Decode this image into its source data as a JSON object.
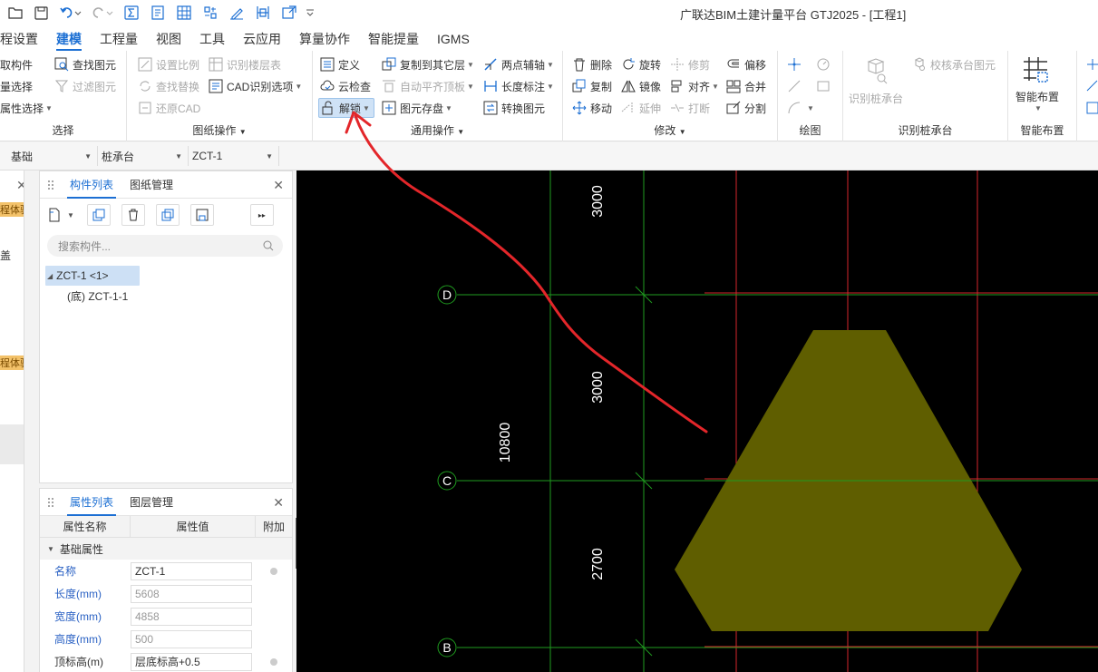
{
  "window": {
    "title": "广联达BIM土建计量平台 GTJ2025 - [工程1]"
  },
  "quick_access": [
    "folder-icon",
    "save-icon",
    "undo-icon",
    "redo-icon",
    "sum-icon",
    "report-icon",
    "grid-icon",
    "layout-icon",
    "pen-icon",
    "split-icon",
    "export-icon",
    "more-icon"
  ],
  "menu": {
    "tabs": [
      "程设置",
      "建模",
      "工程量",
      "视图",
      "工具",
      "云应用",
      "算量协作",
      "智能提量",
      "IGMS"
    ],
    "active": 1
  },
  "ribbon": {
    "select": {
      "items": [
        "取构件",
        "量选择",
        "属性选择"
      ],
      "label": "选择"
    },
    "drawing": {
      "items": [
        "查找图元",
        "过滤图元",
        "设置比例",
        "查找替换",
        "还原CAD",
        "识别楼层表",
        "CAD识别选项"
      ],
      "label": "图纸操作"
    },
    "common": {
      "items": [
        "定义",
        "云检查",
        "解锁",
        "复制到其它层",
        "自动平齐顶板",
        "图元存盘",
        "两点辅轴",
        "长度标注",
        "转换图元"
      ],
      "label": "通用操作"
    },
    "modify": {
      "items": [
        "删除",
        "旋转",
        "修剪",
        "偏移",
        "复制",
        "镜像",
        "对齐",
        "合并",
        "移动",
        "延伸",
        "打断",
        "分割"
      ],
      "label": "修改"
    },
    "draw": {
      "label": "绘图"
    },
    "identify": {
      "items": [
        "识别桩承台",
        "校核承台图元"
      ],
      "label": "识别桩承台"
    },
    "smart": {
      "items": [
        "智能布置"
      ],
      "label": "智能布置"
    }
  },
  "selectors": {
    "floor": "基础",
    "type": "桩承台",
    "component": "ZCT-1"
  },
  "edge_badges": [
    "程体验",
    "程体验"
  ],
  "edge_text": "盖",
  "component_panel": {
    "tabs": [
      "构件列表",
      "图纸管理"
    ],
    "search_placeholder": "搜索构件...",
    "tree": [
      "ZCT-1 <1>",
      "(底) ZCT-1-1"
    ]
  },
  "property_panel": {
    "tabs": [
      "属性列表",
      "图层管理"
    ],
    "headers": [
      "属性名称",
      "属性值",
      "附加"
    ],
    "section": "基础属性",
    "rows": [
      {
        "name": "名称",
        "value": "ZCT-1"
      },
      {
        "name": "长度(mm)",
        "value": "5608"
      },
      {
        "name": "宽度(mm)",
        "value": "4858"
      },
      {
        "name": "高度(mm)",
        "value": "500"
      },
      {
        "name": "顶标高(m)",
        "value": "层底标高+0.5"
      }
    ]
  },
  "canvas": {
    "axes": [
      "D",
      "C",
      "B"
    ],
    "dims": [
      "3000",
      "3000",
      "2700",
      "10800"
    ],
    "colors": {
      "background": "#000000",
      "axis": "#1f9b1f",
      "red_grid": "#d4262c",
      "pile_cap": "#5f5e00"
    }
  }
}
